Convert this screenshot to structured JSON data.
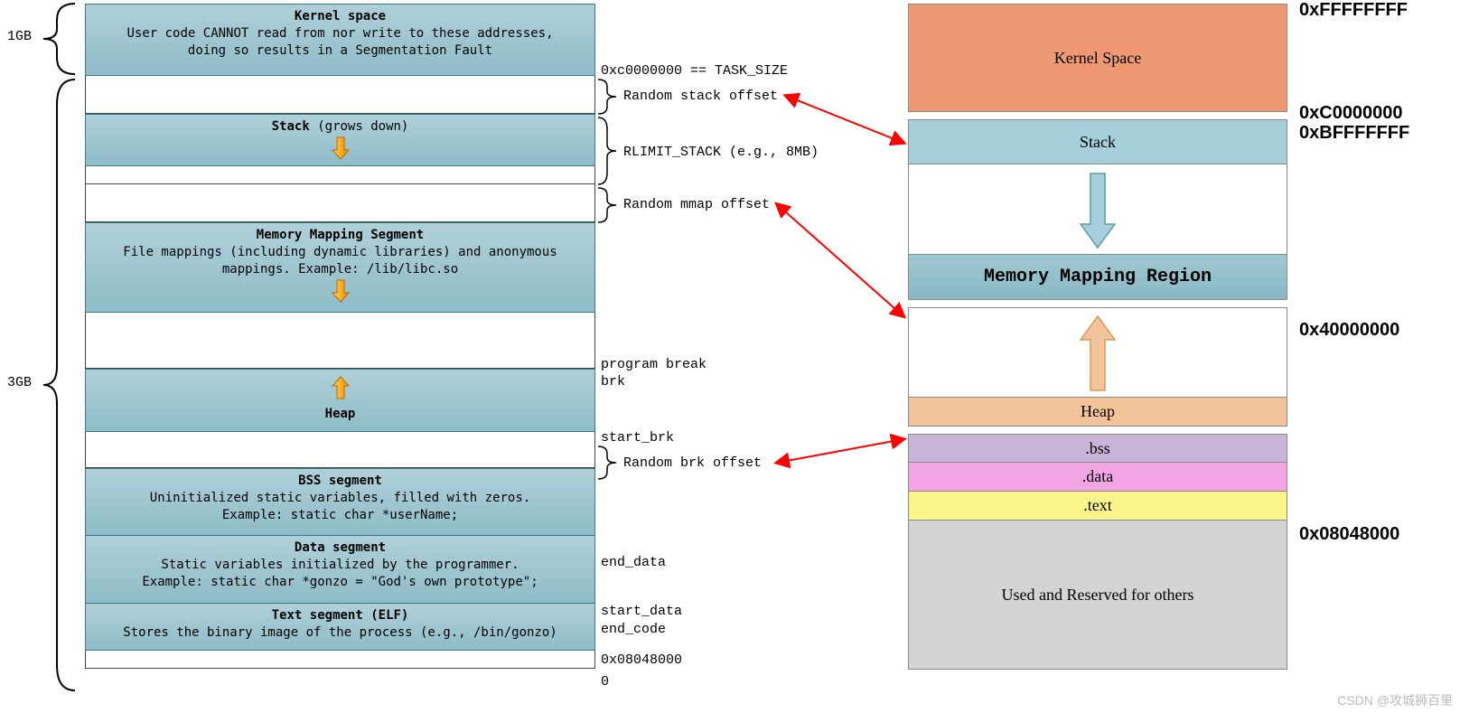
{
  "left_labels": {
    "one_gb": "1GB",
    "three_gb": "3GB"
  },
  "left": {
    "kernel": {
      "title": "Kernel space",
      "desc1": "User code CANNOT read from nor write to these addresses,",
      "desc2": "doing so results in a Segmentation Fault"
    },
    "stack": {
      "title": "Stack",
      "growth": " (grows down)"
    },
    "mmap": {
      "title": "Memory Mapping Segment",
      "desc1": "File mappings (including dynamic libraries) and anonymous",
      "desc2": "mappings. Example: /lib/libc.so"
    },
    "heap": {
      "title": "Heap"
    },
    "bss": {
      "title": "BSS segment",
      "desc1": "Uninitialized static variables, filled with zeros.",
      "desc2": "Example: static char *userName;"
    },
    "data": {
      "title": "Data segment",
      "desc1": "Static variables initialized by the programmer.",
      "desc2": "Example: static char *gonzo = \"God's own prototype\";"
    },
    "text": {
      "title": "Text segment (ELF)",
      "desc1": "Stores the binary image of the process (e.g., /bin/gonzo)"
    }
  },
  "annotations": {
    "task_size": "0xc0000000 == TASK_SIZE",
    "random_stack": "Random stack offset",
    "rlimit": "RLIMIT_STACK (e.g., 8MB)",
    "random_mmap": "Random mmap offset",
    "program_break": "program break",
    "brk": "brk",
    "start_brk": "start_brk",
    "random_brk": "Random brk offset",
    "end_data": "end_data",
    "start_data": "start_data",
    "end_code": "end_code",
    "addr_08048000": "0x08048000",
    "zero": "0"
  },
  "right": {
    "kernel": "Kernel Space",
    "stack": "Stack",
    "mmap": "Memory Mapping Region",
    "heap": "Heap",
    "bss": ".bss",
    "data": ".data",
    "text": ".text",
    "reserved": "Used and Reserved for others"
  },
  "addresses": {
    "ff": "0xFFFFFFFF",
    "c0": "0xC0000000",
    "bf": "0xBFFFFFFF",
    "40": "0x40000000",
    "08": "0x08048000"
  },
  "watermark": "CSDN @攻城狮百里"
}
